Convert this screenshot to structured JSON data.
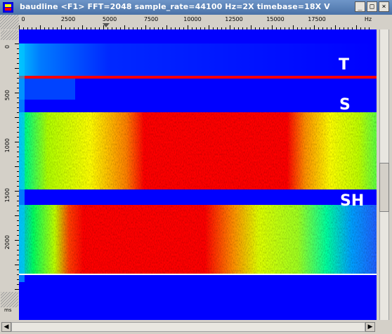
{
  "window": {
    "title": "baudline  <F1> FFT=2048 sample_rate=44100 Hz=2X timebase=18X  V",
    "buttons": {
      "minimize": "_",
      "maximize": "□",
      "close": "×"
    }
  },
  "freq_axis": {
    "unit": "Hz",
    "ticks": [
      "0",
      "2500",
      "5000",
      "7500",
      "10000",
      "12500",
      "15000",
      "17500"
    ]
  },
  "time_axis": {
    "unit": "ms",
    "ticks": [
      "0",
      "500",
      "1000",
      "1500",
      "2000"
    ]
  },
  "bands": [
    {
      "label": "T"
    },
    {
      "label": "S"
    },
    {
      "label": "SH"
    }
  ],
  "colors": {
    "background": "#0000ff",
    "high_energy": "#ff0000",
    "mid_energy": "#ffff00",
    "low_energy": "#00ff00"
  },
  "scroll": {
    "left_arrow": "◀",
    "right_arrow": "▶"
  }
}
